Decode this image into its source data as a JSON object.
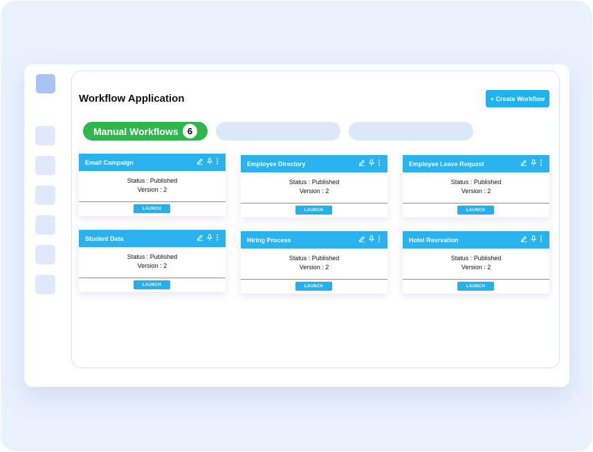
{
  "app": {
    "title": "Workflow Application",
    "create_button": "+ Create Workflow"
  },
  "tabs": {
    "active_label": "Manual Workflows",
    "active_count": "6"
  },
  "cards": [
    {
      "title": "Email Campaign",
      "status": "Status : Published",
      "version": "Version : 2",
      "launch": "LAUNCH"
    },
    {
      "title": "Employee Directory",
      "status": "Status : Published",
      "version": "Version : 2",
      "launch": "LAUNCH"
    },
    {
      "title": "Employee Leave Request",
      "status": "Status : Published",
      "version": "Version : 2",
      "launch": "LAUNCH"
    },
    {
      "title": "Student Data",
      "status": "Status : Published",
      "version": "Version : 2",
      "launch": "LAUNCH"
    },
    {
      "title": "Hiring Process",
      "status": "Status : Published",
      "version": "Version : 2",
      "launch": "LAUNCH"
    },
    {
      "title": "Hotel Resrvation",
      "status": "Status : Published",
      "version": "Version : 2",
      "launch": "LAUNCH"
    }
  ],
  "icons": {
    "card_actions": [
      "pencil-icon",
      "pin-icon",
      "more-vertical-icon"
    ]
  },
  "colors": {
    "accent_blue": "#2ab2ee",
    "active_tab_green": "#2fb64c",
    "background": "#e9f1fd",
    "sidebar_placeholder": "#dfe9fb"
  }
}
